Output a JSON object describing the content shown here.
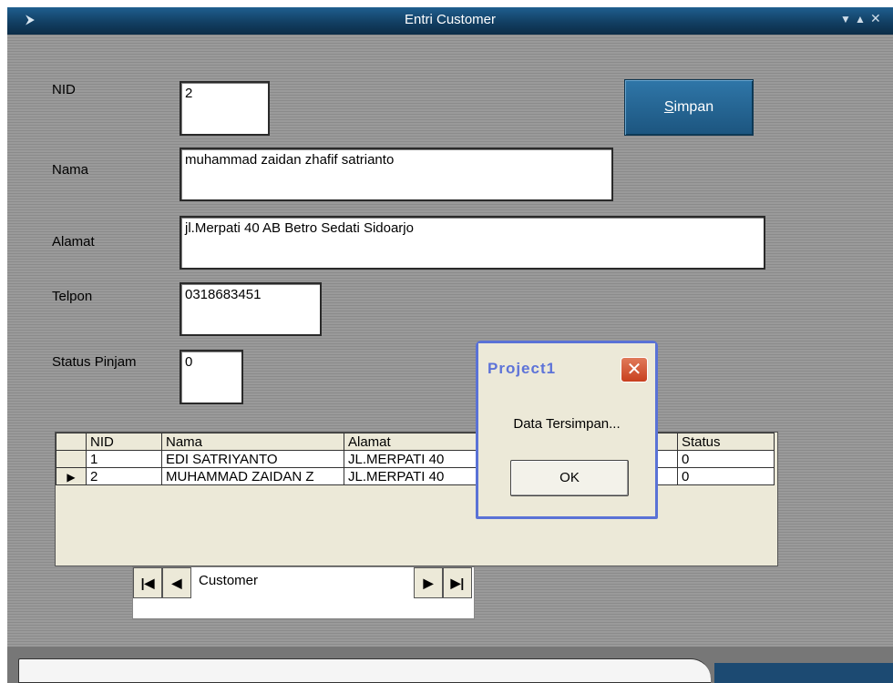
{
  "window": {
    "title": "Entri Customer"
  },
  "form": {
    "nid": {
      "label": "NID",
      "value": "2"
    },
    "nama": {
      "label": "Nama",
      "value": "muhammad zaidan zhafif satrianto"
    },
    "alamat": {
      "label": "Alamat",
      "value": "jl.Merpati 40 AB Betro Sedati Sidoarjo"
    },
    "telpon": {
      "label": "Telpon",
      "value": "0318683451"
    },
    "status": {
      "label": "Status Pinjam",
      "value": "0"
    },
    "save_label": "Simpan",
    "save_mnemonic": "S",
    "save_rest": "impan"
  },
  "grid": {
    "columns": [
      "NID",
      "Nama",
      "Alamat",
      "Status"
    ],
    "rows": [
      {
        "nid": "1",
        "nama": "EDI SATRIYANTO",
        "alamat": "JL.MERPATI 40",
        "status": "0",
        "selected": false
      },
      {
        "nid": "2",
        "nama": "MUHAMMAD ZAIDAN Z",
        "alamat": "JL.MERPATI 40",
        "status": "0",
        "selected": true
      }
    ]
  },
  "navigator": {
    "caption": "Customer"
  },
  "messagebox": {
    "title": "Project1",
    "message": "Data Tersimpan...",
    "ok_label": "OK"
  }
}
